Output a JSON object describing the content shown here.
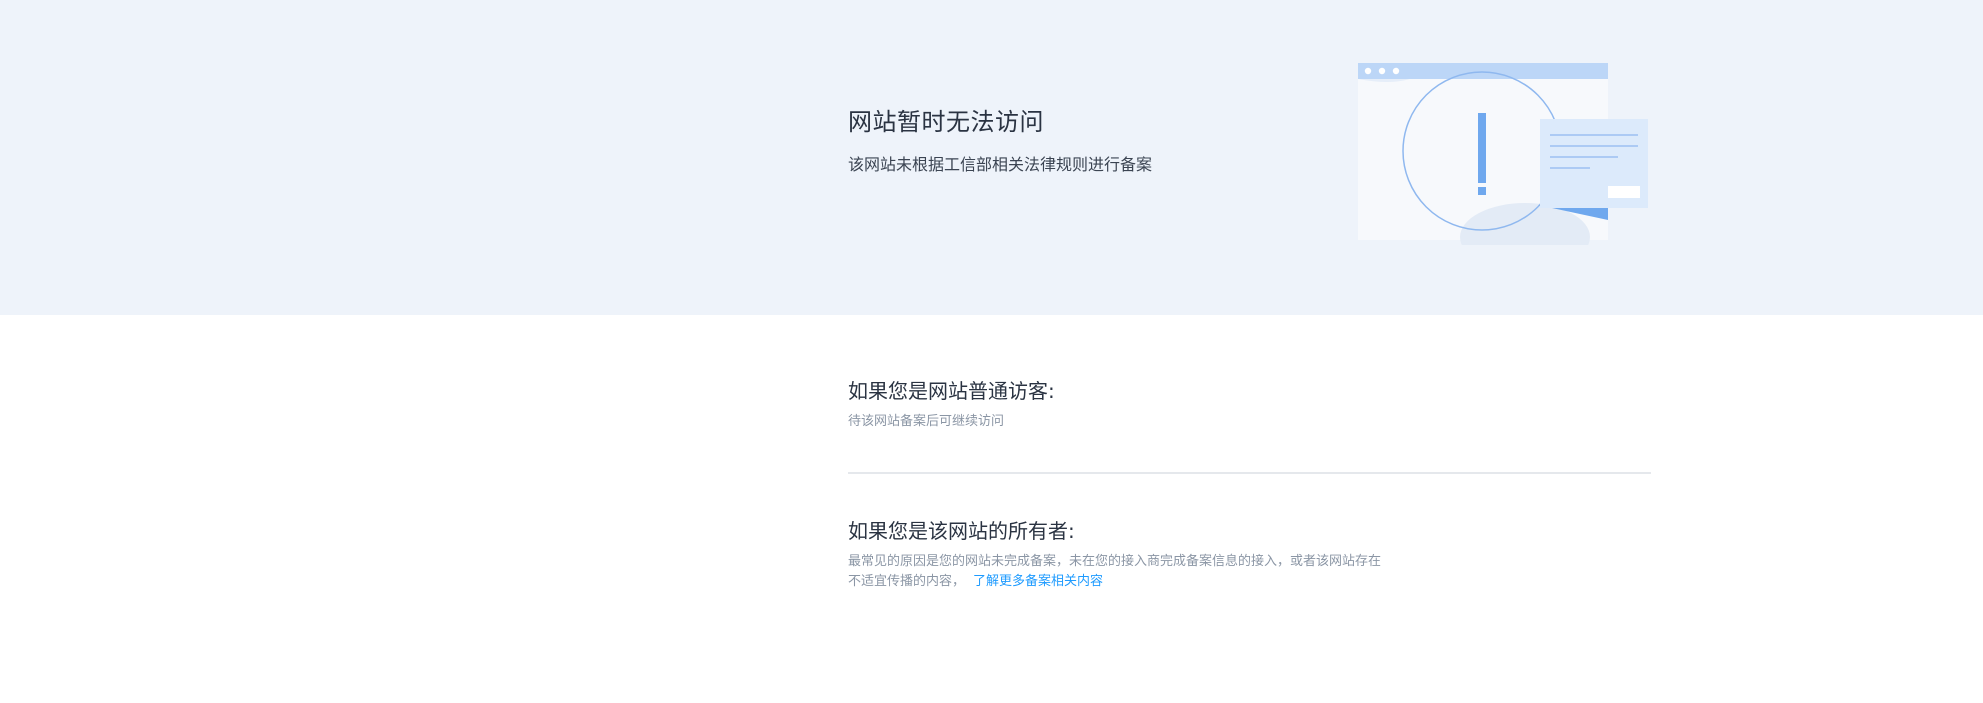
{
  "banner": {
    "title": "网站暂时无法访问",
    "subtitle": "该网站未根据工信部相关法律规则进行备案",
    "illustration_icon": "warning-browser-illustration"
  },
  "visitor": {
    "title": "如果您是网站普通访客:",
    "text": "待该网站备案后可继续访问"
  },
  "owner": {
    "title": "如果您是该网站的所有者:",
    "text_line1": "最常见的原因是您的网站未完成备案，未在您的接入商完成备案信息的接入，或者该网站存在",
    "text_line2": "不适宜传播的内容，",
    "link": "了解更多备案相关内容"
  },
  "colors": {
    "banner_bg": "#eef3fa",
    "accent": "#1e9bff",
    "illustration_blue": "#6fa8ee"
  }
}
